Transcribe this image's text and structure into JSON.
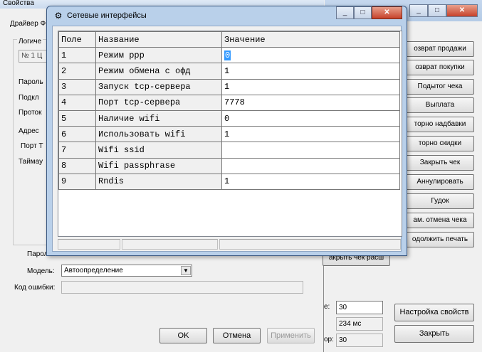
{
  "background_window": {
    "title": "Свойства",
    "driver_label": "Драйвер Ф",
    "logical_group_label": "Логиче",
    "logical_input_value": "№ 1 Ц",
    "left_labels": [
      "Пароль",
      "Подкл",
      "Проток",
      "Адрес",
      "Порт Т",
      "Таймау"
    ],
    "password_label": "Пароль",
    "model_label": "Модель:",
    "model_value": "Автоопределение",
    "error_code_label": "Код ошибки:",
    "ok_label": "OK",
    "cancel_label": "Отмена",
    "apply_label": "Применить"
  },
  "right_window": {
    "buttons": [
      "озврат продажи",
      "озврат покупки",
      "Подытог чека",
      "Выплата",
      "торно надбавки",
      "торно скидки",
      "Закрыть чек",
      "Аннулировать",
      "Гудок",
      "ам. отмена чека",
      "одолжить печать"
    ],
    "close_cheque_label": "акрыть чек расш",
    "field_a_value": "30",
    "field_b_value": "234 мс",
    "field_c_label": "ор:",
    "field_c_value": "30",
    "field_a_label": "e:",
    "setup_button": "Настройка свойств",
    "close_button": "Закрыть"
  },
  "dialog": {
    "title": "Сетевые интерфейсы",
    "columns": [
      "Поле",
      "Название",
      "Значение"
    ],
    "rows": [
      {
        "field": "1",
        "name": "Режим ppp",
        "value": "0"
      },
      {
        "field": "2",
        "name": "Режим обмена с офд",
        "value": "1"
      },
      {
        "field": "3",
        "name": "Запуск tcp-сервера",
        "value": "1"
      },
      {
        "field": "4",
        "name": "Порт tcp-сервера",
        "value": "7778"
      },
      {
        "field": "5",
        "name": "Наличие wifi",
        "value": "0"
      },
      {
        "field": "6",
        "name": "Использовать wifi",
        "value": "1"
      },
      {
        "field": "7",
        "name": "Wifi ssid",
        "value": ""
      },
      {
        "field": "8",
        "name": "Wifi passphrase",
        "value": ""
      },
      {
        "field": "9",
        "name": "Rndis",
        "value": "1"
      }
    ]
  },
  "icons": {
    "dialog_icon": "network-icon",
    "minimize": "minimize-icon",
    "maximize": "maximize-icon",
    "close": "close-icon",
    "dropdown": "chevron-down-icon"
  },
  "colors": {
    "selection": "#3399ff",
    "titlebar": "#b9d0ea",
    "close_button": "#c7412a"
  }
}
